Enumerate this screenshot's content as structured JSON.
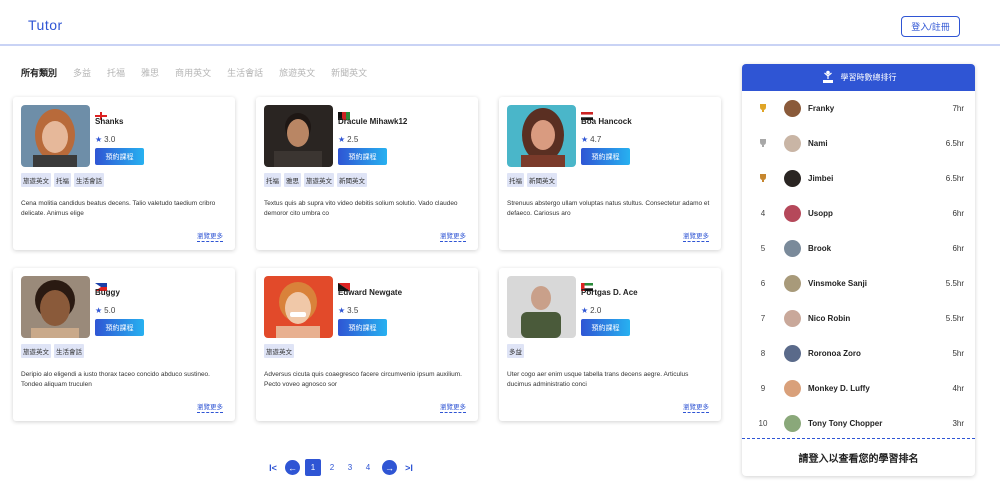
{
  "header": {
    "brand": "Tutor",
    "login_label": "登入/註冊"
  },
  "tabs": [
    "所有類別",
    "多益",
    "托福",
    "雅思",
    "商用英文",
    "生活會話",
    "旅遊英文",
    "新聞英文"
  ],
  "tutors": [
    {
      "name": "Shanks",
      "rating": "3.0",
      "book_label": "預約課程",
      "tags": [
        "旅遊英文",
        "托福",
        "生活會話"
      ],
      "description": "Cena molitia candidus beatus decens. Talio valetudo taedium cribro delicate. Animus elige",
      "more_label": "瀏覽更多",
      "flag": "england",
      "photo": "woman-red-hair"
    },
    {
      "name": "Dracule Mihawk12",
      "rating": "2.5",
      "book_label": "預約課程",
      "tags": [
        "托福",
        "雅思",
        "旅遊英文",
        "新聞英文"
      ],
      "description": "Textus quis ab supra vito video debitis solium solutio. Vado claudeo demoror cito umbra co",
      "more_label": "瀏覽更多",
      "flag": "afghanistan",
      "photo": "man-dark-hair"
    },
    {
      "name": "Boa Hancock",
      "rating": "4.7",
      "book_label": "預約課程",
      "tags": [
        "托福",
        "新聞英文"
      ],
      "description": "Strenuus abstergo ullam voluptas natus stultus. Consectetur adamo et defaeco. Cariosus aro",
      "more_label": "瀏覽更多",
      "flag": "egypt",
      "photo": "woman-brown-hair"
    },
    {
      "name": "Buggy",
      "rating": "5.0",
      "book_label": "預約課程",
      "tags": [
        "旅遊英文",
        "生活會話"
      ],
      "description": "Deripio alo eligendi a iusto thorax taceo concido abduco sustineo. Tondeo aliquam truculen",
      "more_label": "瀏覽更多",
      "flag": "philippines",
      "photo": "girl-child"
    },
    {
      "name": "Edward Newgate",
      "rating": "3.5",
      "book_label": "預約課程",
      "tags": [
        "旅遊英文"
      ],
      "description": "Adversus cicuta quis coaegresco facere circumvenio ipsum auxilium. Pecto voveo agnosco sor",
      "more_label": "瀏覽更多",
      "flag": "papua-new-guinea",
      "photo": "woman-smiling"
    },
    {
      "name": "Portgas D. Ace",
      "rating": "2.0",
      "book_label": "預約課程",
      "tags": [
        "多益"
      ],
      "description": "Uter cogo aer enim usque tabella trans decens aegre. Articulus ducimus administratio conci",
      "more_label": "瀏覽更多",
      "flag": "uae",
      "photo": "man-bald"
    }
  ],
  "pager": {
    "first": "I<",
    "last": ">I",
    "pages": [
      "1",
      "2",
      "3",
      "4"
    ],
    "current": "1"
  },
  "ranking": {
    "title": "學習時數總排行",
    "rows": [
      {
        "pos": "",
        "medal": "gold",
        "name": "Franky",
        "hours": "7hr"
      },
      {
        "pos": "",
        "medal": "silver",
        "name": "Nami",
        "hours": "6.5hr"
      },
      {
        "pos": "",
        "medal": "bronze",
        "name": "Jimbei",
        "hours": "6.5hr"
      },
      {
        "pos": "4",
        "medal": "",
        "name": "Usopp",
        "hours": "6hr"
      },
      {
        "pos": "5",
        "medal": "",
        "name": "Brook",
        "hours": "6hr"
      },
      {
        "pos": "6",
        "medal": "",
        "name": "Vinsmoke Sanji",
        "hours": "5.5hr"
      },
      {
        "pos": "7",
        "medal": "",
        "name": "Nico Robin",
        "hours": "5.5hr"
      },
      {
        "pos": "8",
        "medal": "",
        "name": "Roronoa Zoro",
        "hours": "5hr"
      },
      {
        "pos": "9",
        "medal": "",
        "name": "Monkey D. Luffy",
        "hours": "4hr"
      },
      {
        "pos": "10",
        "medal": "",
        "name": "Tony Tony Chopper",
        "hours": "3hr"
      }
    ],
    "footer": "請登入以查看您的學習排名"
  },
  "colors": {
    "accent": "#2f55d4",
    "accent_light": "#27b1f0",
    "tag_bg": "#dfe4f6",
    "gold": "#e0a526",
    "silver": "#a8a8a8",
    "bronze": "#c6862e"
  }
}
